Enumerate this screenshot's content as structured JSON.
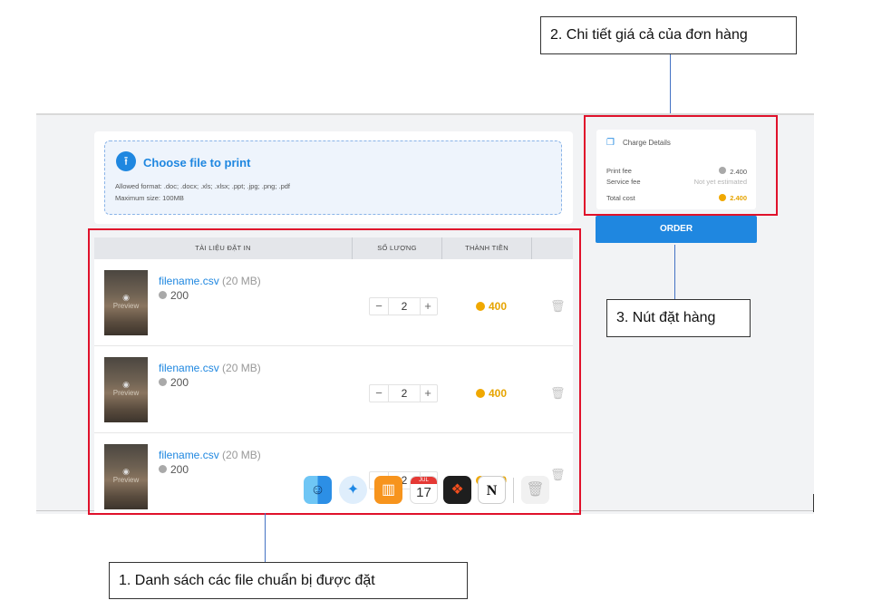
{
  "upload": {
    "title": "Choose file to print",
    "allowed_formats": "Allowed format: .doc; .docx; .xls; .xlsx; .ppt; .jpg; .png; .pdf",
    "max_size": "Maximum size: 100MB"
  },
  "table": {
    "headers": [
      "TÀI LIỆU ĐẶT IN",
      "SỐ LƯỢNG",
      "THÀNH TIỀN"
    ],
    "rows": [
      {
        "filename": "filename.csv",
        "size": "(20 MB)",
        "pages": "200",
        "qty": "2",
        "subtotal": "400",
        "preview_label": "Preview"
      },
      {
        "filename": "filename.csv",
        "size": "(20 MB)",
        "pages": "200",
        "qty": "2",
        "subtotal": "400",
        "preview_label": "Preview"
      },
      {
        "filename": "filename.csv",
        "size": "(20 MB)",
        "pages": "200",
        "qty": "2",
        "subtotal": "400",
        "preview_label": "Preview"
      }
    ],
    "minus": "−",
    "plus": "+"
  },
  "charge": {
    "title": "Charge Details",
    "print_fee_label": "Print fee",
    "print_fee": "2.400",
    "service_fee_label": "Service fee",
    "service_fee": "Not yet estimated",
    "total_label": "Total cost",
    "total": "2.400"
  },
  "order_button": "ORDER",
  "dock": {
    "calendar_month": "JUL",
    "calendar_day": "17",
    "apps": [
      "finder-icon",
      "safari-icon",
      "books-icon",
      "calendar-icon",
      "figma-icon",
      "notion-icon",
      "trash-icon"
    ]
  },
  "annotations": {
    "note1": "1. Danh sách các file chuẩn bị được đặt",
    "note2": "2.  Chi tiết giá cả của đơn hàng",
    "note3": "3. Nút đặt hàng"
  },
  "colors": {
    "accent": "#1f87e0",
    "coin_gold": "#f0a800",
    "annotation_red": "#e0112b"
  }
}
